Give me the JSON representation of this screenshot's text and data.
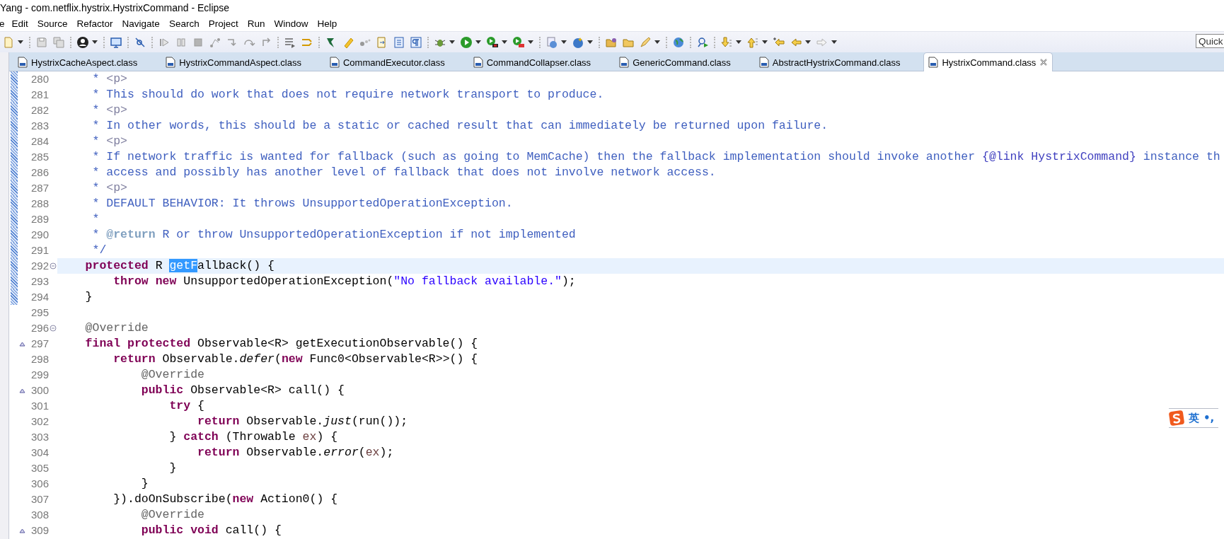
{
  "window": {
    "title": "Yang - com.netflix.hystrix.HystrixCommand - Eclipse"
  },
  "menu": [
    "e",
    "Edit",
    "Source",
    "Refactor",
    "Navigate",
    "Search",
    "Project",
    "Run",
    "Window",
    "Help"
  ],
  "quick_access": {
    "placeholder": "Quick"
  },
  "tabs": [
    {
      "label": "HystrixCacheAspect.class",
      "selected": false
    },
    {
      "label": "HystrixCommandAspect.class",
      "selected": false
    },
    {
      "label": "CommandExecutor.class",
      "selected": false
    },
    {
      "label": "CommandCollapser.class",
      "selected": false
    },
    {
      "label": "GenericCommand.class",
      "selected": false
    },
    {
      "label": "AbstractHystrixCommand.class",
      "selected": false
    },
    {
      "label": "HystrixCommand.class",
      "selected": true
    }
  ],
  "editor": {
    "lines": [
      {
        "number": "280",
        "kind": "code",
        "in_range": true,
        "current": false,
        "tokens": [
          {
            "kind": "comment",
            "text": "     * "
          },
          {
            "kind": "html",
            "text": "<p>"
          }
        ]
      },
      {
        "number": "281",
        "kind": "code",
        "in_range": true,
        "current": false,
        "tokens": [
          {
            "kind": "comment",
            "text": "     * This should do work that does not require network transport to produce."
          }
        ]
      },
      {
        "number": "282",
        "kind": "code",
        "in_range": true,
        "current": false,
        "tokens": [
          {
            "kind": "comment",
            "text": "     * "
          },
          {
            "kind": "html",
            "text": "<p>"
          }
        ]
      },
      {
        "number": "283",
        "kind": "code",
        "in_range": true,
        "current": false,
        "tokens": [
          {
            "kind": "comment",
            "text": "     * In other words, this should be a static or cached result that can immediately be returned upon failure."
          }
        ]
      },
      {
        "number": "284",
        "kind": "code",
        "in_range": true,
        "current": false,
        "tokens": [
          {
            "kind": "comment",
            "text": "     * "
          },
          {
            "kind": "html",
            "text": "<p>"
          }
        ]
      },
      {
        "number": "285",
        "kind": "code",
        "in_range": true,
        "current": false,
        "tokens": [
          {
            "kind": "comment",
            "text": "     * If network traffic is wanted for fallback (such as going to MemCache) then the fallback implementation should invoke another "
          },
          {
            "kind": "link",
            "text": "{@link HystrixCommand}"
          },
          {
            "kind": "comment",
            "text": " instance th"
          }
        ]
      },
      {
        "number": "286",
        "kind": "code",
        "in_range": true,
        "current": false,
        "tokens": [
          {
            "kind": "comment",
            "text": "     * access and possibly has another level of fallback that does not involve network access."
          }
        ]
      },
      {
        "number": "287",
        "kind": "code",
        "in_range": true,
        "current": false,
        "tokens": [
          {
            "kind": "comment",
            "text": "     * "
          },
          {
            "kind": "html",
            "text": "<p>"
          }
        ]
      },
      {
        "number": "288",
        "kind": "code",
        "in_range": true,
        "current": false,
        "tokens": [
          {
            "kind": "comment",
            "text": "     * DEFAULT BEHAVIOR: It throws UnsupportedOperationException."
          }
        ]
      },
      {
        "number": "289",
        "kind": "code",
        "in_range": true,
        "current": false,
        "tokens": [
          {
            "kind": "comment",
            "text": "     *"
          }
        ]
      },
      {
        "number": "290",
        "kind": "code",
        "in_range": true,
        "current": false,
        "tokens": [
          {
            "kind": "comment",
            "text": "     * "
          },
          {
            "kind": "tag",
            "text": "@return"
          },
          {
            "kind": "comment",
            "text": " R or throw UnsupportedOperationException if not implemented"
          }
        ]
      },
      {
        "number": "291",
        "kind": "code",
        "in_range": true,
        "current": false,
        "tokens": [
          {
            "kind": "comment",
            "text": "     */"
          }
        ]
      },
      {
        "number": "292",
        "kind": "fold",
        "in_range": true,
        "current": true,
        "tokens": [
          {
            "kind": "keyword",
            "text": "    protected"
          },
          {
            "kind": "plain",
            "text": " R "
          },
          {
            "kind": "selection",
            "text": "getF"
          },
          {
            "kind": "plain",
            "text": "allback() {"
          }
        ]
      },
      {
        "number": "293",
        "kind": "code",
        "in_range": true,
        "current": false,
        "tokens": [
          {
            "kind": "keyword",
            "text": "        throw"
          },
          {
            "kind": "keyword",
            "text": " new"
          },
          {
            "kind": "plain",
            "text": " UnsupportedOperationException("
          },
          {
            "kind": "string",
            "text": "\"No fallback available.\""
          },
          {
            "kind": "plain",
            "text": ");"
          }
        ]
      },
      {
        "number": "294",
        "kind": "code",
        "in_range": true,
        "current": false,
        "tokens": [
          {
            "kind": "plain",
            "text": "    }"
          }
        ]
      },
      {
        "number": "295",
        "kind": "code",
        "in_range": false,
        "current": false
      },
      {
        "number": "296",
        "kind": "fold",
        "in_range": false,
        "current": false,
        "tokens": [
          {
            "kind": "annotation",
            "text": "    @Override"
          }
        ]
      },
      {
        "number": "297",
        "kind": "override",
        "in_range": false,
        "current": false,
        "tokens": [
          {
            "kind": "keyword",
            "text": "    final"
          },
          {
            "kind": "keyword",
            "text": " protected"
          },
          {
            "kind": "plain",
            "text": " Observable<R> getExecutionObservable() {"
          }
        ]
      },
      {
        "number": "298",
        "kind": "code",
        "in_range": false,
        "current": false,
        "tokens": [
          {
            "kind": "keyword",
            "text": "        return"
          },
          {
            "kind": "plain",
            "text": " Observable."
          },
          {
            "kind": "static",
            "text": "defer"
          },
          {
            "kind": "plain",
            "text": "("
          },
          {
            "kind": "keyword",
            "text": "new"
          },
          {
            "kind": "plain",
            "text": " Func0<Observable<R>>() {"
          }
        ]
      },
      {
        "number": "299",
        "kind": "code",
        "in_range": false,
        "current": false,
        "tokens": [
          {
            "kind": "annotation",
            "text": "            @Override"
          }
        ]
      },
      {
        "number": "300",
        "kind": "override",
        "in_range": false,
        "current": false,
        "tokens": [
          {
            "kind": "keyword",
            "text": "            public"
          },
          {
            "kind": "plain",
            "text": " Observable<R> call() {"
          }
        ]
      },
      {
        "number": "301",
        "kind": "code",
        "in_range": false,
        "current": false,
        "tokens": [
          {
            "kind": "keyword",
            "text": "                try"
          },
          {
            "kind": "plain",
            "text": " {"
          }
        ]
      },
      {
        "number": "302",
        "kind": "code",
        "in_range": false,
        "current": false,
        "tokens": [
          {
            "kind": "keyword",
            "text": "                    return"
          },
          {
            "kind": "plain",
            "text": " Observable."
          },
          {
            "kind": "static",
            "text": "just"
          },
          {
            "kind": "plain",
            "text": "(run());"
          }
        ]
      },
      {
        "number": "303",
        "kind": "code",
        "in_range": false,
        "current": false,
        "tokens": [
          {
            "kind": "plain",
            "text": "                } "
          },
          {
            "kind": "keyword",
            "text": "catch"
          },
          {
            "kind": "plain",
            "text": " (Throwable "
          },
          {
            "kind": "variable",
            "text": "ex"
          },
          {
            "kind": "plain",
            "text": ") {"
          }
        ]
      },
      {
        "number": "304",
        "kind": "code",
        "in_range": false,
        "current": false,
        "tokens": [
          {
            "kind": "keyword",
            "text": "                    return"
          },
          {
            "kind": "plain",
            "text": " Observable."
          },
          {
            "kind": "static",
            "text": "error"
          },
          {
            "kind": "plain",
            "text": "("
          },
          {
            "kind": "variable",
            "text": "ex"
          },
          {
            "kind": "plain",
            "text": ");"
          }
        ]
      },
      {
        "number": "305",
        "kind": "code",
        "in_range": false,
        "current": false,
        "tokens": [
          {
            "kind": "plain",
            "text": "                }"
          }
        ]
      },
      {
        "number": "306",
        "kind": "code",
        "in_range": false,
        "current": false,
        "tokens": [
          {
            "kind": "plain",
            "text": "            }"
          }
        ]
      },
      {
        "number": "307",
        "kind": "code",
        "in_range": false,
        "current": false,
        "tokens": [
          {
            "kind": "plain",
            "text": "        }).doOnSubscribe("
          },
          {
            "kind": "keyword",
            "text": "new"
          },
          {
            "kind": "plain",
            "text": " Action0() {"
          }
        ]
      },
      {
        "number": "308",
        "kind": "code",
        "in_range": false,
        "current": false,
        "tokens": [
          {
            "kind": "annotation",
            "text": "            @Override"
          }
        ]
      },
      {
        "number": "309",
        "kind": "override",
        "in_range": false,
        "current": false,
        "tokens": [
          {
            "kind": "keyword",
            "text": "            public"
          },
          {
            "kind": "keyword",
            "text": " void"
          },
          {
            "kind": "plain",
            "text": " call() {"
          }
        ]
      }
    ]
  },
  "ime_bar": {
    "labels": [
      "英",
      "•,"
    ]
  }
}
